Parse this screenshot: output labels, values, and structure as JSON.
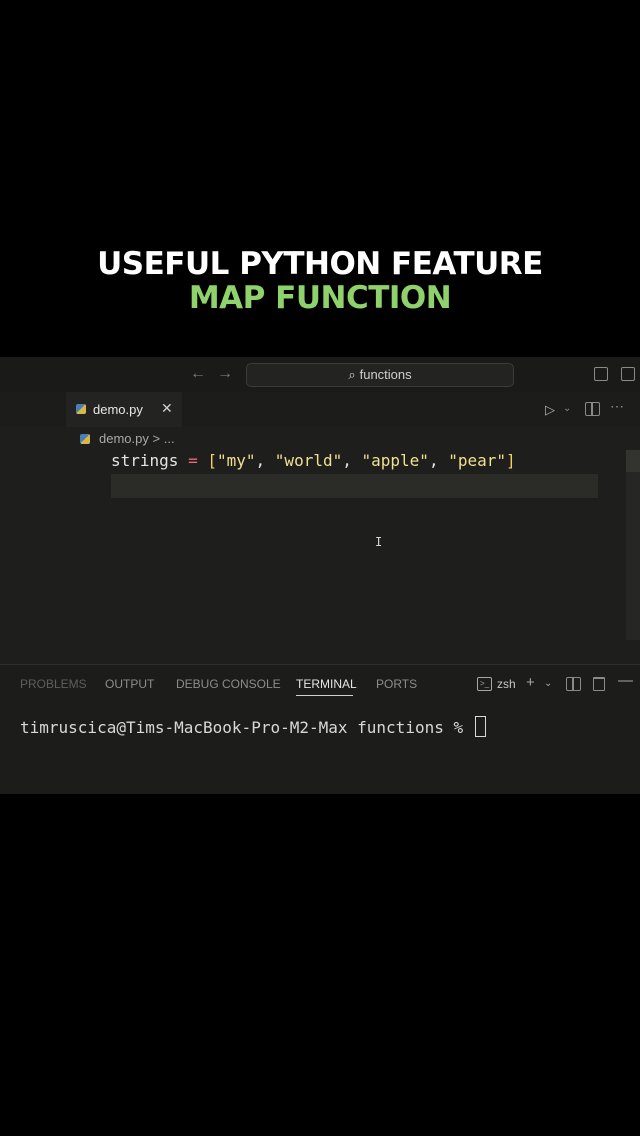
{
  "caption": {
    "line1": "USEFUL PYTHON FEATURE",
    "line2": "MAP FUNCTION",
    "line2_color": "#8fd16a"
  },
  "titlebar": {
    "back_icon": "arrow-left-icon",
    "forward_icon": "arrow-right-icon",
    "search_text": "functions"
  },
  "tab": {
    "label": "demo.py",
    "close": "✕"
  },
  "breadcrumb": {
    "file": "demo.py",
    "separator": ">",
    "rest": "..."
  },
  "code": {
    "line1": {
      "var": "strings",
      "op": "=",
      "open": "[",
      "items": [
        "\"my\"",
        "\"world\"",
        "\"apple\"",
        "\"pear\""
      ],
      "close": "]"
    }
  },
  "panel": {
    "tabs": [
      "PROBLEMS",
      "OUTPUT",
      "DEBUG CONSOLE",
      "TERMINAL",
      "PORTS"
    ],
    "active_tab": "TERMINAL",
    "shell": "zsh"
  },
  "terminal": {
    "prompt": "timruscica@Tims-MacBook-Pro-M2-Max functions % "
  },
  "colors": {
    "editor_bg": "#1e1e1c",
    "keyword_op": "#ea6a7a",
    "string": "#f0e090"
  }
}
